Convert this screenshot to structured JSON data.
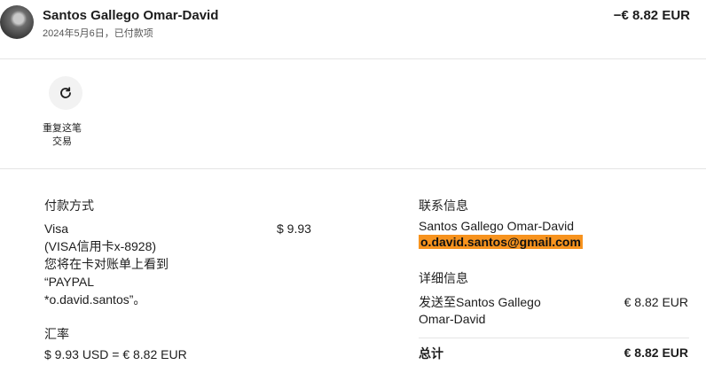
{
  "header": {
    "merchant": "Santos Gallego Omar-David",
    "date_status": "2024年5月6日，已付款项",
    "amount": "−€ 8.82 EUR"
  },
  "actions": {
    "repeat_label": "重复这笔交易"
  },
  "payment": {
    "title": "付款方式",
    "method_lines": [
      "Visa",
      "(VISA信用卡x-8928)",
      "您将在卡对账单上看到",
      "“PAYPAL",
      "*o.david.santos”。"
    ],
    "amount": "$ 9.93"
  },
  "exchange": {
    "title": "汇率",
    "value": "$ 9.93 USD = € 8.82 EUR"
  },
  "contact": {
    "title": "联系信息",
    "name": "Santos Gallego Omar-David",
    "email": "o.david.santos@gmail.com"
  },
  "details": {
    "title": "详细信息",
    "sent_to_line1": "发送至Santos Gallego",
    "sent_to_line2": "Omar-David",
    "sent_amount": "€ 8.82 EUR",
    "total_label": "总计",
    "total_amount": "€ 8.82 EUR"
  },
  "icons": {
    "repeat": "refresh-icon"
  }
}
